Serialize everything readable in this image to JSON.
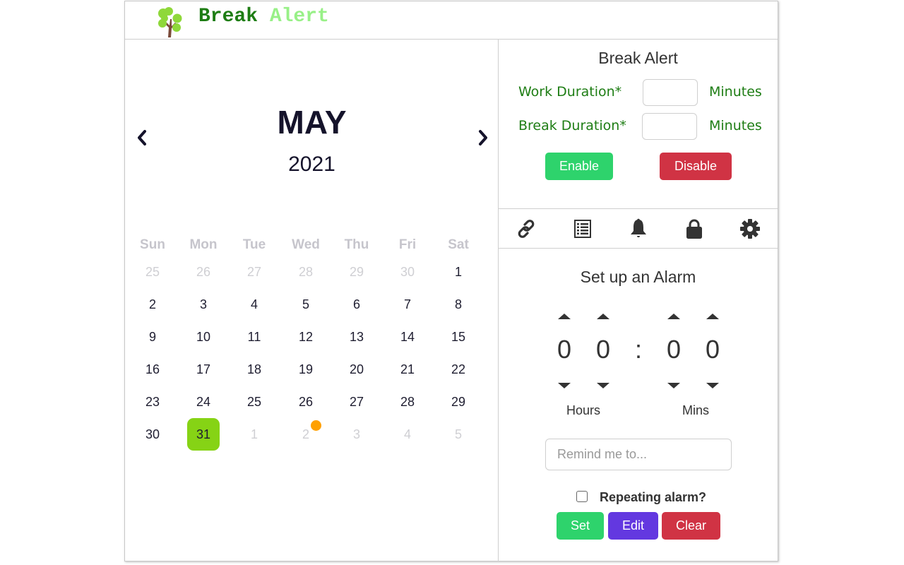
{
  "app": {
    "title_part1": "Break",
    "title_part2": "Alert",
    "logo_icon": "tree-icon",
    "colors": {
      "title_dark_green": "#1e7d14",
      "title_light_green": "#98f087"
    }
  },
  "calendar": {
    "month": "MAY",
    "year": "2021",
    "prev_icon": "chevron-left-icon",
    "next_icon": "chevron-right-icon",
    "weekdays": [
      "Sun",
      "Mon",
      "Tue",
      "Wed",
      "Thu",
      "Fri",
      "Sat"
    ],
    "weeks": [
      [
        {
          "d": "25",
          "m": true
        },
        {
          "d": "26",
          "m": true
        },
        {
          "d": "27",
          "m": true
        },
        {
          "d": "28",
          "m": true
        },
        {
          "d": "29",
          "m": true
        },
        {
          "d": "30",
          "m": true
        },
        {
          "d": "1"
        }
      ],
      [
        {
          "d": "2"
        },
        {
          "d": "3"
        },
        {
          "d": "4"
        },
        {
          "d": "5"
        },
        {
          "d": "6"
        },
        {
          "d": "7"
        },
        {
          "d": "8"
        }
      ],
      [
        {
          "d": "9"
        },
        {
          "d": "10"
        },
        {
          "d": "11"
        },
        {
          "d": "12"
        },
        {
          "d": "13"
        },
        {
          "d": "14"
        },
        {
          "d": "15"
        }
      ],
      [
        {
          "d": "16"
        },
        {
          "d": "17"
        },
        {
          "d": "18"
        },
        {
          "d": "19"
        },
        {
          "d": "20"
        },
        {
          "d": "21"
        },
        {
          "d": "22"
        }
      ],
      [
        {
          "d": "23"
        },
        {
          "d": "24"
        },
        {
          "d": "25"
        },
        {
          "d": "26"
        },
        {
          "d": "27"
        },
        {
          "d": "28"
        },
        {
          "d": "29"
        }
      ],
      [
        {
          "d": "30"
        },
        {
          "d": "31",
          "today": true
        },
        {
          "d": "1",
          "m": true
        },
        {
          "d": "2",
          "m": true,
          "event": true
        },
        {
          "d": "3",
          "m": true
        },
        {
          "d": "4",
          "m": true
        },
        {
          "d": "5",
          "m": true
        }
      ]
    ],
    "today_color": "#86d315",
    "event_dot_color": "#ffa000"
  },
  "break_alert": {
    "title": "Break Alert",
    "work_label": "Work Duration*",
    "work_value": "",
    "break_label": "Break Duration*",
    "break_value": "",
    "unit": "Minutes",
    "enable_label": "Enable",
    "disable_label": "Disable"
  },
  "toolbar": {
    "icons": [
      "link-icon",
      "list-icon",
      "bell-icon",
      "lock-icon",
      "gear-icon"
    ]
  },
  "alarm": {
    "title": "Set up an Alarm",
    "digits": [
      "0",
      "0",
      "0",
      "0"
    ],
    "separator": ":",
    "hours_label": "Hours",
    "mins_label": "Mins",
    "remind_placeholder": "Remind me to...",
    "remind_value": "",
    "repeating_label": "Repeating alarm?",
    "repeating_checked": false,
    "set_label": "Set",
    "edit_label": "Edit",
    "clear_label": "Clear"
  }
}
